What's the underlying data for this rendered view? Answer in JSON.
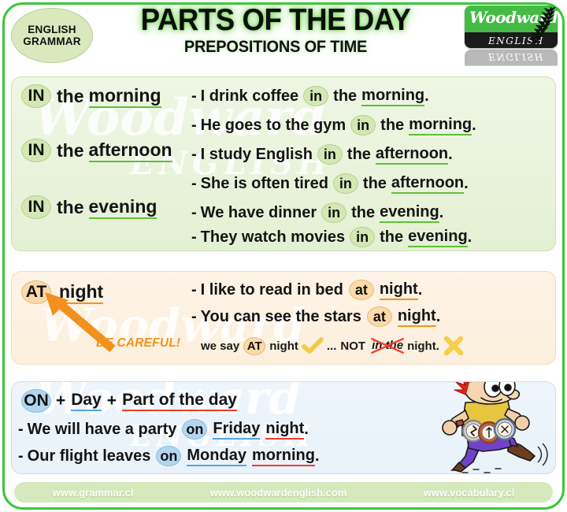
{
  "header": {
    "badge_line1": "ENGLISH",
    "badge_line2": "GRAMMAR",
    "title": "PARTS OF THE DAY",
    "subtitle": "PREPOSITIONS OF TIME",
    "logo_word": "Woodward",
    "logo_reg": "®",
    "logo_sub": "ENGLISH"
  },
  "watermark": {
    "line1": "Woodward",
    "line2": "ENGLISH"
  },
  "in_section": {
    "accent_color": "#5ec037",
    "circle_color": "#d4e8b4",
    "entries": [
      {
        "prep": "IN",
        "article": "the",
        "noun": "morning"
      },
      {
        "prep": "IN",
        "article": "the",
        "noun": "afternoon"
      },
      {
        "prep": "IN",
        "article": "the",
        "noun": "evening"
      }
    ],
    "examples": [
      {
        "dash": "-",
        "before": "I drink coffee",
        "prep": "in",
        "mid": "the",
        "noun": "morning",
        "end": "."
      },
      {
        "dash": "-",
        "before": "He goes to the gym",
        "prep": "in",
        "mid": "the",
        "noun": "morning",
        "end": "."
      },
      {
        "dash": "-",
        "before": "I study English",
        "prep": "in",
        "mid": "the",
        "noun": "afternoon",
        "end": "."
      },
      {
        "dash": "-",
        "before": "She is often tired",
        "prep": "in",
        "mid": "the",
        "noun": "afternoon",
        "end": "."
      },
      {
        "dash": "-",
        "before": "We have dinner",
        "prep": "in",
        "mid": "the",
        "noun": "evening",
        "end": "."
      },
      {
        "dash": "-",
        "before": "They watch movies",
        "prep": "in",
        "mid": "the",
        "noun": "evening",
        "end": "."
      }
    ]
  },
  "at_section": {
    "accent_color": "#f0951e",
    "circle_color": "#fbd9a8",
    "heading_prep": "AT",
    "heading_noun": "night",
    "examples": [
      {
        "dash": "-",
        "before": "I like to read in bed",
        "prep": "at",
        "noun": "night",
        "end": "."
      },
      {
        "dash": "-",
        "before": "You can see the stars",
        "prep": "at",
        "noun": "night",
        "end": "."
      }
    ],
    "careful_label": "BE CAREFUL!",
    "note": {
      "prefix": "we say",
      "correct_prep": "AT",
      "correct_noun": "night",
      "check_mark": "check-mark",
      "ellipsis": "...",
      "not_label": "NOT",
      "wrong_phrase": "in the",
      "wrong_noun": "night.",
      "cross_mark": "cross-mark"
    }
  },
  "on_section": {
    "day_color": "#56a5dd",
    "part_color": "#ee3b33",
    "circle_color": "#b3d6ef",
    "formula": {
      "prep": "ON",
      "plus1": "+",
      "day": "Day",
      "plus2": "+",
      "part": "Part of the day"
    },
    "examples": [
      {
        "dash": "-",
        "before": "We will have a party",
        "prep": "on",
        "day": "Friday",
        "part": "night",
        "end": "."
      },
      {
        "dash": "-",
        "before": "Our flight leaves",
        "prep": "on",
        "day": "Monday",
        "part": "morning",
        "end": "."
      }
    ]
  },
  "footer": {
    "link1": "www.grammar.cl",
    "link2": "www.woodwardenglish.com",
    "link3": "www.vocabulary.cl"
  }
}
